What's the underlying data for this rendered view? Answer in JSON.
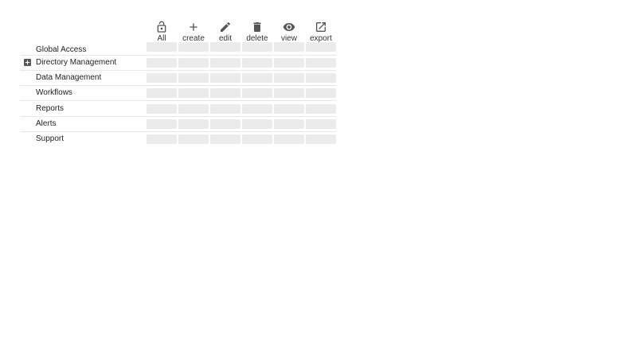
{
  "columns": [
    {
      "label": "All",
      "icon": "lock-open-icon"
    },
    {
      "label": "create",
      "icon": "plus-icon"
    },
    {
      "label": "edit",
      "icon": "pencil-icon"
    },
    {
      "label": "delete",
      "icon": "trash-icon"
    },
    {
      "label": "view",
      "icon": "eye-icon"
    },
    {
      "label": "export",
      "icon": "external-link-icon"
    }
  ],
  "rows": [
    {
      "label": "Global Access",
      "expandable": false
    },
    {
      "label": "Directory Management",
      "expandable": true,
      "expand_icon": "plus-square-icon"
    },
    {
      "label": "Data Management",
      "expandable": false
    },
    {
      "label": "Workflows",
      "expandable": false
    },
    {
      "label": "Reports",
      "expandable": false
    },
    {
      "label": "Alerts",
      "expandable": false
    },
    {
      "label": "Support",
      "expandable": false
    }
  ],
  "colors": {
    "icon": "#555555",
    "cell": "#ebebeb",
    "divider": "#e8e8e8",
    "text": "#222222"
  }
}
